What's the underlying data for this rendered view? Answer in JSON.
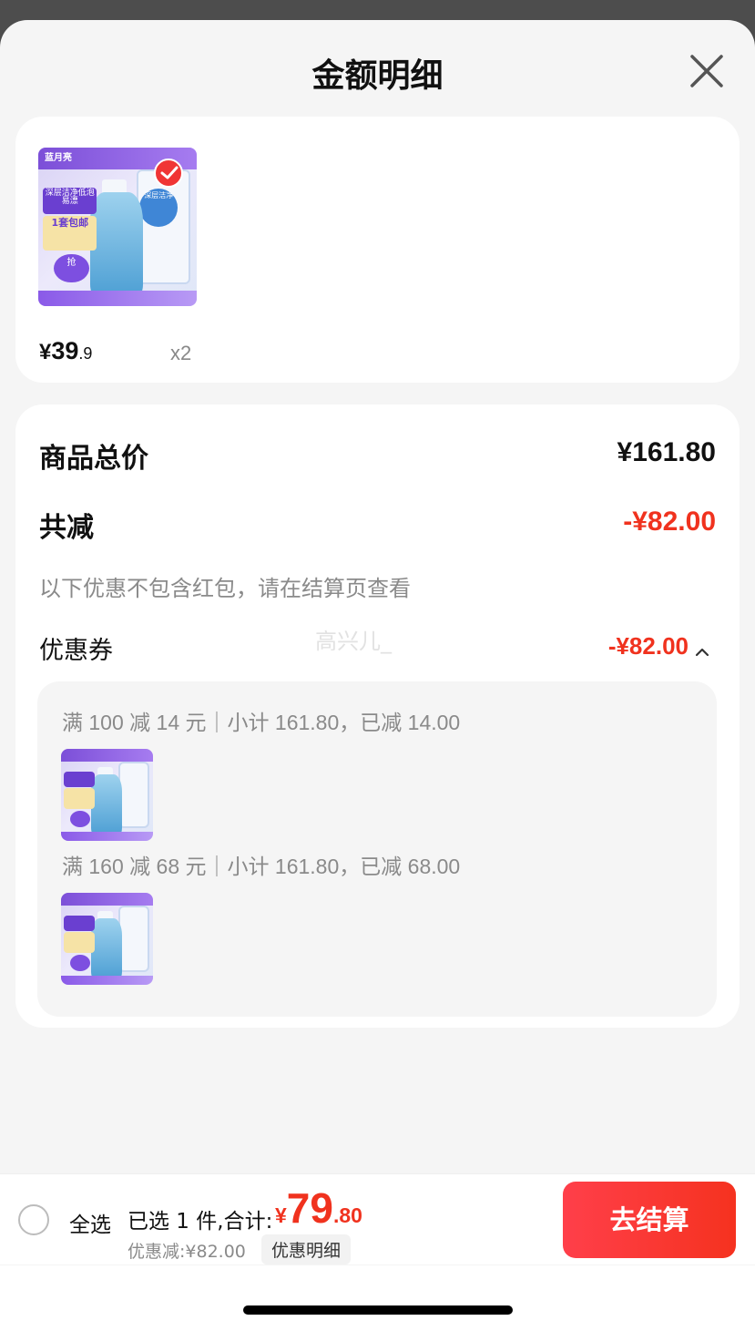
{
  "sheet": {
    "title": "金额明细"
  },
  "product": {
    "brand": "蓝月亮",
    "art": {
      "tag1": "深层洁净低泡易漂",
      "tag2": "1套包邮",
      "tag3": "抢",
      "badge": "深层洁净"
    },
    "price_symbol": "¥",
    "price_integer": "39",
    "price_decimal": ".9",
    "quantity": "x2",
    "selected": true
  },
  "summary": {
    "total_label": "商品总价",
    "total_value": "¥161.80",
    "reduction_label": "共减",
    "reduction_value": "-¥82.00",
    "note": "以下优惠不包含红包，请在结算页查看",
    "coupon_label": "优惠券",
    "coupon_value": "-¥82.00",
    "coupon_rules": [
      {
        "text": "满 100 减 14 元｜小计 161.80，已减 14.00"
      },
      {
        "text": "满 160 减 68 元｜小计 161.80，已减 68.00"
      }
    ]
  },
  "watermark": "高兴儿_",
  "bottom_bar": {
    "select_all": "全选",
    "selected_text": "已选 1 件,合计:",
    "total_symbol": "¥",
    "total_integer": "79",
    "total_decimal": ".80",
    "discount_text": "优惠减:¥82.00",
    "detail_button": "优惠明细",
    "checkout_button": "去结算"
  },
  "colors": {
    "accent_red": "#f0321e",
    "checkout_gradient_start": "#ff3f4a",
    "checkout_gradient_end": "#f5321f"
  }
}
